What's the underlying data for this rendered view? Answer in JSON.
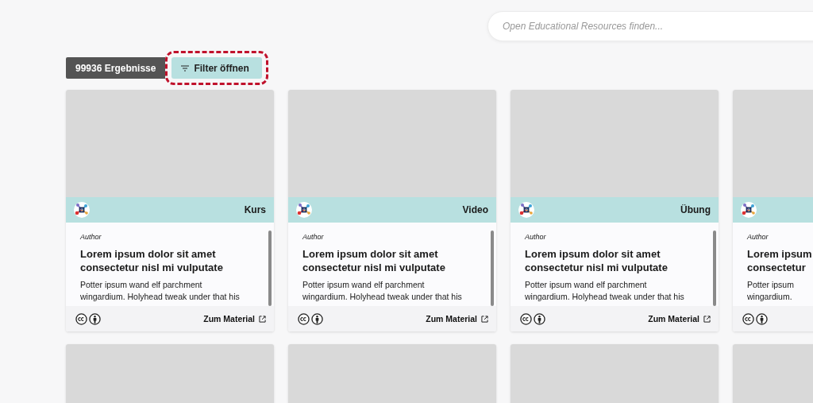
{
  "search": {
    "placeholder": "Open Educational Resources finden..."
  },
  "results": {
    "count_label": "99936 Ergebnisse"
  },
  "filter_button": {
    "label": "Filter öffnen",
    "focused": true
  },
  "cards": [
    {
      "kind": "full",
      "type": "Kurs",
      "author": "Author",
      "title": "Lorem ipsum dolor sit amet\nconsectetur nisl mi vulputate",
      "description": "Potter ipsum wand elf parchment\nwingardium. Holyhead tweak under that his",
      "link": "Zum Material"
    },
    {
      "kind": "full",
      "type": "Video",
      "author": "Author",
      "title": "Lorem ipsum dolor sit amet\nconsectetur nisl mi vulputate",
      "description": "Potter ipsum wand elf parchment\nwingardium. Holyhead tweak under that his",
      "link": "Zum Material"
    },
    {
      "kind": "full",
      "type": "Übung",
      "author": "Author",
      "title": "Lorem ipsum dolor sit amet\nconsectetur nisl mi vulputate",
      "description": "Potter ipsum wand elf parchment\nwingardium. Holyhead tweak under that his",
      "link": "Zum Material"
    },
    {
      "kind": "partial",
      "author": "Author",
      "title": "Lorem ipsum\nconsectetur",
      "description": "Potter ipsum\nwingardium."
    },
    {
      "kind": "placeholder"
    },
    {
      "kind": "placeholder"
    },
    {
      "kind": "placeholder"
    },
    {
      "kind": "placeholder"
    }
  ]
}
